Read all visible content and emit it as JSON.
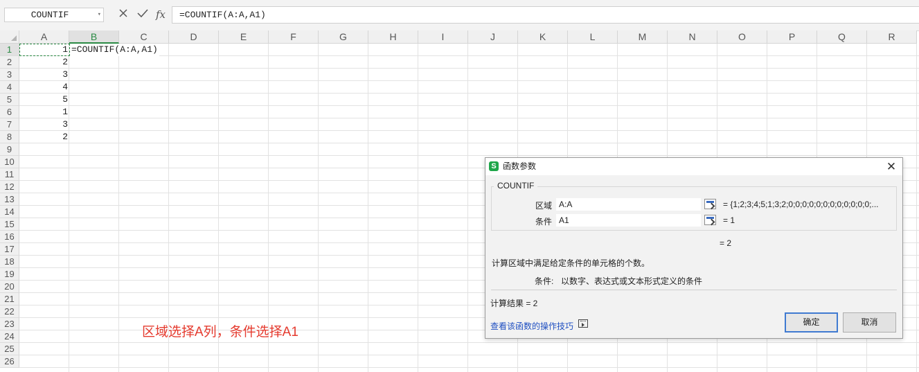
{
  "formula_bar": {
    "name_box": "COUNTIF",
    "cancel_icon": "close-icon",
    "confirm_icon": "check-icon",
    "fx_label": "fx",
    "formula": "=COUNTIF(A:A,A1)"
  },
  "sheet": {
    "columns": [
      "A",
      "B",
      "C",
      "D",
      "E",
      "F",
      "G",
      "H",
      "I",
      "J",
      "K",
      "L",
      "M",
      "N",
      "O",
      "P",
      "Q",
      "R"
    ],
    "selected_column": "B",
    "rows": [
      "1",
      "2",
      "3",
      "4",
      "5",
      "6",
      "7",
      "8",
      "9",
      "10",
      "11",
      "12",
      "13",
      "14",
      "15",
      "16",
      "17",
      "18",
      "19",
      "20",
      "21",
      "22",
      "23",
      "24",
      "25",
      "26"
    ],
    "selected_row": "1",
    "column_a_values": [
      "1",
      "2",
      "3",
      "4",
      "5",
      "1",
      "3",
      "2"
    ],
    "b1_text": "=COUNTIF(A:A,A1)",
    "annotation": "区域选择A列，条件选择A1",
    "annotation_color": "#e53a2e",
    "accent_color": "#2a8a44"
  },
  "dialog": {
    "title": "函数参数",
    "app_icon": "wps-s-icon",
    "function_name": "COUNTIF",
    "args": [
      {
        "label": "区域",
        "value": "A:A",
        "result": "= {1;2;3;4;5;1;3;2;0;0;0;0;0;0;0;0;0;0;0;0;..."
      },
      {
        "label": "条件",
        "value": "A1",
        "result": "= 1"
      }
    ],
    "formula_result": "= 2",
    "description": "计算区域中满足给定条件的单元格的个数。",
    "arg_help_label": "条件:",
    "arg_help_text": "以数字、表达式或文本形式定义的条件",
    "calc_result": "计算结果 = 2",
    "tips_link": "查看该函数的操作技巧",
    "ok_label": "确定",
    "cancel_label": "取消"
  }
}
